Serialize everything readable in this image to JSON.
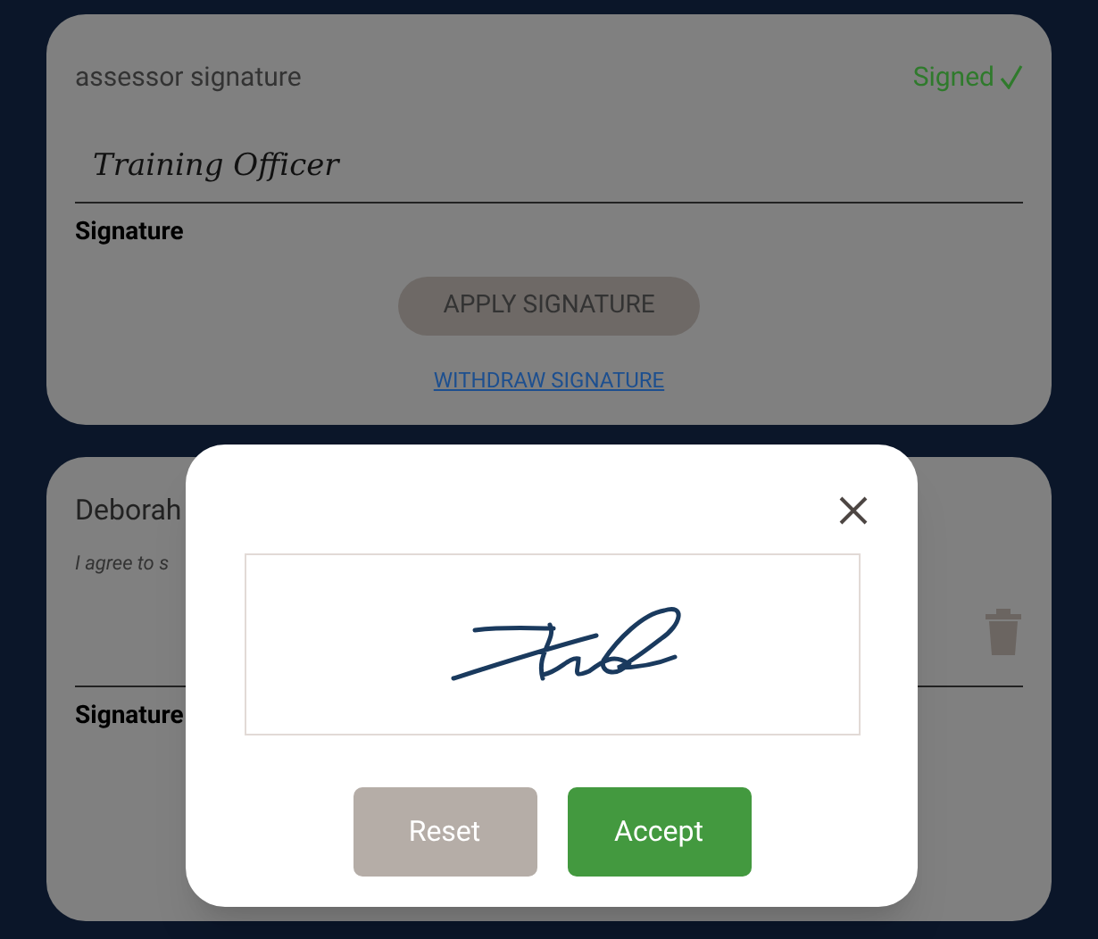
{
  "cards": [
    {
      "title": "assessor signature",
      "status": "Signed",
      "signed": true,
      "signature_text": "Training Officer",
      "field_label": "Signature",
      "apply_button": "APPLY SIGNATURE",
      "withdraw_link": "WITHDRAW SIGNATURE"
    },
    {
      "title": "Deborah",
      "agreement": "I agree to s",
      "field_label": "Signature"
    }
  ],
  "dialog": {
    "reset_button": "Reset",
    "accept_button": "Accept"
  }
}
